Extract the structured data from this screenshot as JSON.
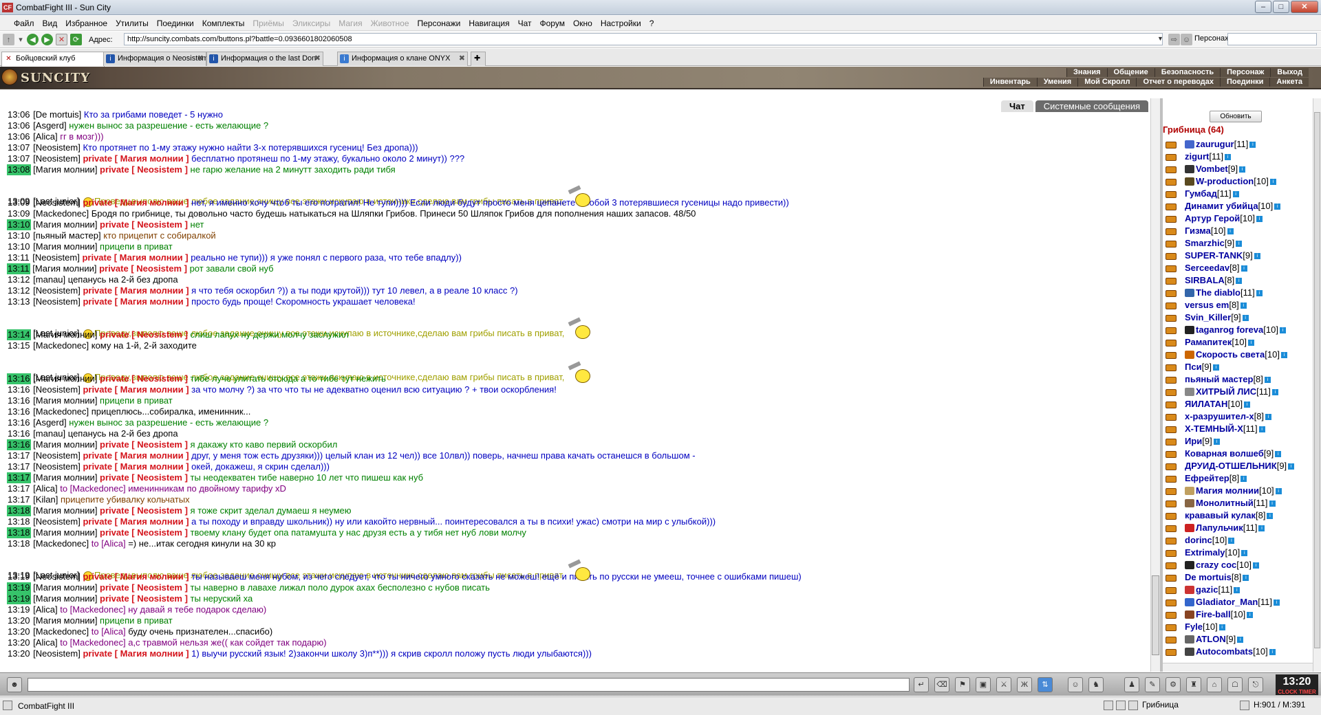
{
  "window": {
    "title": "CombatFight III - Sun City"
  },
  "menu": [
    "Файл",
    "Вид",
    "Избранное",
    "Утилиты",
    "Поединки",
    "Комплекты",
    "Приёмы",
    "Эликсиры",
    "Магия",
    "Животное",
    "Персонажи",
    "Навигация",
    "Чат",
    "Форум",
    "Окно",
    "Настройки",
    "?"
  ],
  "menu_disabled": [
    6,
    7,
    8,
    9
  ],
  "address": {
    "label": "Адрес:",
    "url": "http://suncity.combats.com/buttons.pl?battle=0.0936601802060508",
    "persona_label": "Персонаж:"
  },
  "tabs": [
    {
      "label": "Бойцовский клуб",
      "active": true
    },
    {
      "label": "Информация о Neosistem"
    },
    {
      "label": "Информация о the last Don"
    },
    {
      "label": "Информация о клане ONYX"
    }
  ],
  "header": {
    "logo": "SUNCITY",
    "top_links": [
      "Знания",
      "Общение",
      "Безопасность",
      "Персонаж",
      "Выход"
    ],
    "bottom_links": [
      "Инвентарь",
      "Умения",
      "Мой Скролл",
      "Отчет о переводах",
      "Поединки",
      "Анкета"
    ]
  },
  "chat_tabs": [
    {
      "label": "Чат",
      "active": true
    },
    {
      "label": "Системные сообщения"
    }
  ],
  "chat_lines": [
    {
      "t": "13:06",
      "n": "De mortuis",
      "m": "Кто за грибами поведет - 5 нужно",
      "c": "blue"
    },
    {
      "t": "13:06",
      "n": "Asgerd",
      "m": "нужен вынос за разрешение - есть желающие ?",
      "c": "green"
    },
    {
      "t": "13:06",
      "n": "Alica",
      "m": "гг в мозг)))",
      "c": "purple"
    },
    {
      "t": "13:07",
      "n": "Neosistem",
      "m": "Кто протянет по 1-му этажу нужно найти 3-х потерявшихся гусениц! Без дропа)))",
      "c": "blue"
    },
    {
      "t": "13:07",
      "n": "Neosistem",
      "p": "Магия молнии",
      "m": "бесплатно протянеш по 1-му этажу, букально около 2 минут)) ???",
      "c": "blue"
    },
    {
      "t": "13:08",
      "hl": true,
      "n": "Магия молнии",
      "p": "Neosistem",
      "m": "не гарю желание на 2 минутт заходить ради тибя",
      "c": "green"
    },
    {
      "t": "13:09",
      "n": "Last junior",
      "m": "Проведу,выполю ваше любое задание,очищу все этажи,искупаю в источнике,сделаю вам грибы писать в приват,",
      "c": "olive",
      "s": true,
      "tall": true
    },
    {
      "t": "13:09",
      "n": "Neosistem",
      "p": "Магия молнии",
      "m": "нет, я именно хочу чтоб ты его потратил! Не тупи)))) Если люди будут просто меня цепанете с собой 3 потерявшиеся гусеницы надо привести))",
      "c": "blue"
    },
    {
      "t": "13:09",
      "n": "Mackedonec",
      "m": "Бродя по грибнице, ты довольно часто будешь натыкаться на Шляпки Грибов. Принеси 50 Шляпок Грибов для пополнения наших запасов. 48/50",
      "c": "dark"
    },
    {
      "t": "13:10",
      "hl": true,
      "n": "Магия молнии",
      "p": "Neosistem",
      "m": "нет",
      "c": "green"
    },
    {
      "t": "13:10",
      "n": "пьяный мастер",
      "m": "кто прицепит с собиралкой",
      "c": "brown"
    },
    {
      "t": "13:10",
      "n": "Магия молнии",
      "m": "прицепи в приват",
      "c": "green"
    },
    {
      "t": "13:11",
      "n": "Neosistem",
      "p": "Магия молнии",
      "m": "реально не тупи))) я уже понял с первого раза, что тебе впадлу))",
      "c": "blue"
    },
    {
      "t": "13:11",
      "hl": true,
      "n": "Магия молнии",
      "p": "Neosistem",
      "m": "рот завали свой нуб",
      "c": "green"
    },
    {
      "t": "13:12",
      "n": "manau",
      "m": "цепанусь на 2-й без дропа",
      "c": "dark"
    },
    {
      "t": "13:12",
      "n": "Neosistem",
      "p": "Магия молнии",
      "m": "я что тебя оскорбил ?)) а ты поди крутой))) тут 10 левел, а в реале 10 класс ?)",
      "c": "blue"
    },
    {
      "t": "13:13",
      "n": "Neosistem",
      "p": "Магия молнии",
      "m": "просто будь проще! Скоромность украшает человека!",
      "c": "blue"
    },
    {
      "t": "13:14",
      "n": "Last junior",
      "m": "Проведу,выполю ваше любое задание,очищу все этажи,искупаю в источнике,сделаю вам грибы писать в приват,",
      "c": "olive",
      "s": true,
      "tall": true
    },
    {
      "t": "13:14",
      "hl": true,
      "n": "Магия молнии",
      "p": "Neosistem",
      "m": "слиш лапух ну держи молчу заслужил",
      "c": "green"
    },
    {
      "t": "13:15",
      "n": "Mackedonec",
      "m": "кому на 1-й, 2-й заходите",
      "c": "dark"
    },
    {
      "t": "13:15",
      "n": "Last junior",
      "m": "Проведу,выполю ваше любое задание,очищу все этажи,искупаю в источнике,сделаю вам грибы писать в приват,",
      "c": "olive",
      "s": true,
      "tall": true
    },
    {
      "t": "13:16",
      "hl": true,
      "n": "Магия молнии",
      "p": "Neosistem",
      "m": "тибе луче улитать отсюда а то тибе тут нежить",
      "c": "green"
    },
    {
      "t": "13:16",
      "n": "Neosistem",
      "p": "Магия молнии",
      "m": "за что молчу ?) за что что ты не адекватно оценил всю ситуацию ? + твои оскорбления!",
      "c": "blue"
    },
    {
      "t": "13:16",
      "n": "Магия молнии",
      "m": "прицепи в приват",
      "c": "green"
    },
    {
      "t": "13:16",
      "n": "Mackedonec",
      "m": "прицеплюсь...собиралка, именинник...",
      "c": "dark"
    },
    {
      "t": "13:16",
      "n": "Asgerd",
      "m": "нужен вынос за разрешение - есть желающие ?",
      "c": "green"
    },
    {
      "t": "13:16",
      "n": "manau",
      "m": "цепанусь на 2-й без дропа",
      "c": "dark"
    },
    {
      "t": "13:16",
      "hl": true,
      "n": "Магия молнии",
      "p": "Neosistem",
      "m": "я дакажу кто каво первий оскорбил",
      "c": "green"
    },
    {
      "t": "13:17",
      "n": "Neosistem",
      "p": "Магия молнии",
      "m": "друг, у меня тож есть друзяки))) целый клан из 12 чел)) все 10лвл)) поверь, начнеш права качать останешся в большом -",
      "c": "blue"
    },
    {
      "t": "13:17",
      "n": "Neosistem",
      "p": "Магия молнии",
      "m": "окей, докажеш, я скрин сделал)))",
      "c": "blue"
    },
    {
      "t": "13:17",
      "hl": true,
      "n": "Магия молнии",
      "p": "Neosistem",
      "m": "ты неодекватен тибе наверно 10 лет что пишеш как нуб",
      "c": "green"
    },
    {
      "t": "13:17",
      "n": "Alica",
      "to": "to [Mackedonec]",
      "m": "именинникам по двойному тарифу xD",
      "c": "purple"
    },
    {
      "t": "13:17",
      "n": "Kilan",
      "m": "прицепите убивалку кольчатых",
      "c": "brown"
    },
    {
      "t": "13:18",
      "hl": true,
      "n": "Магия молнии",
      "p": "Neosistem",
      "m": "я тоже скрит зделал думаеш я неумею",
      "c": "green"
    },
    {
      "t": "13:18",
      "n": "Neosistem",
      "p": "Магия молнии",
      "m": "а ты походу и вправду школьник)) ну или какойто нервный... поинтересовался а ты в психи! ужас) смотри на мир с улыбкой)))",
      "c": "blue"
    },
    {
      "t": "13:18",
      "hl": true,
      "n": "Магия молнии",
      "p": "Neosistem",
      "m": "твоему клану будет опа патамушта у нас друзя есть а у тибя нет нуб лови молчу",
      "c": "green"
    },
    {
      "t": "13:18",
      "n": "Mackedonec",
      "to": "to [Alica]",
      "m": "=) не...итак сегодня кинули на 30 кр",
      "c": "dark"
    },
    {
      "t": "13:19",
      "n": "Last junior",
      "m": "Проведу,выполю ваше любое задание,очищу все этажи,искупаю в источнике,сделаю вам грибы писать в приват,",
      "c": "olive",
      "s": true,
      "tall": true
    },
    {
      "t": "13:19",
      "n": "Neosistem",
      "p": "Магия молнии",
      "m": "ты называеш меня нубом, из чего следует, что ты ничего умного сказать не можеш! ещё и писать по русски не умееш, точнее с ошибками пишеш)",
      "c": "blue"
    },
    {
      "t": "13:19",
      "hl": true,
      "n": "Магия молнии",
      "p": "Neosistem",
      "m": "ты наверно в лавахе лижал поло дурок ахах бесполезно с нубов писать",
      "c": "green"
    },
    {
      "t": "13:19",
      "hl": true,
      "n": "Магия молнии",
      "p": "Neosistem",
      "m": "ты неруский ха",
      "c": "green"
    },
    {
      "t": "13:19",
      "n": "Alica",
      "to": "to [Mackedonec]",
      "m": "ну давай я тебе подарок сделаю)",
      "c": "purple"
    },
    {
      "t": "13:20",
      "n": "Магия молнии",
      "m": "прицепи в приват",
      "c": "green"
    },
    {
      "t": "13:20",
      "n": "Mackedonec",
      "to": "to [Alica]",
      "m": "буду очень признателен...спасибо)",
      "c": "dark"
    },
    {
      "t": "13:20",
      "n": "Alica",
      "to": "to [Mackedonec]",
      "m": "а,с травмой нельзя же(( как сойдет так подарю)",
      "c": "purple"
    },
    {
      "t": "13:20",
      "n": "Neosistem",
      "p": "Магия молнии",
      "m": "1) выучи русский язык! 2)закончи школу 3)п**))) я скрив скролл положу пусть люди улыбаются)))",
      "c": "blue"
    }
  ],
  "panel": {
    "refresh": "Обновить",
    "room": "Грибница (64)"
  },
  "users": [
    {
      "n": "zaurugur",
      "l": "[11]",
      "clan": "#4466cc"
    },
    {
      "n": "zigurt",
      "l": "[11]"
    },
    {
      "n": "Vombet",
      "l": "[9]",
      "clan": "#333"
    },
    {
      "n": "W-production",
      "l": "[10]",
      "clan": "#5a4a20"
    },
    {
      "n": "Гумбад",
      "l": "[11]"
    },
    {
      "n": "Динамит убийца",
      "l": "[10]"
    },
    {
      "n": "Артур Герой",
      "l": "[10]"
    },
    {
      "n": "Гизма",
      "l": "[10]"
    },
    {
      "n": "Smarzhic",
      "l": "[9]"
    },
    {
      "n": "SUPER-TANK",
      "l": "[9]"
    },
    {
      "n": "Serceedav",
      "l": "[8]"
    },
    {
      "n": "SIRBALA",
      "l": "[8]"
    },
    {
      "n": "The diablo",
      "l": "[11]",
      "clan": "#3366aa"
    },
    {
      "n": "versus em",
      "l": "[8]"
    },
    {
      "n": "Svin_Killer",
      "l": "[9]"
    },
    {
      "n": "taganrog foreva",
      "l": "[10]",
      "clan": "#222"
    },
    {
      "n": "Рамапитек",
      "l": "[10]"
    },
    {
      "n": "Скорость света",
      "l": "[10]",
      "clan": "#cc6600"
    },
    {
      "n": "Пси",
      "l": "[9]"
    },
    {
      "n": "пьяный мастер",
      "l": "[8]"
    },
    {
      "n": "ХИТРЫЙ ЛИС",
      "l": "[11]",
      "clan": "#888"
    },
    {
      "n": "ЯИЛАТАН",
      "l": "[10]"
    },
    {
      "n": "x-разрушител-x",
      "l": "[8]"
    },
    {
      "n": "X-ТЕМНЫЙ-X",
      "l": "[11]"
    },
    {
      "n": "Ири",
      "l": "[9]"
    },
    {
      "n": "Коварная волшеб",
      "l": "[9]"
    },
    {
      "n": "ДРУИД-ОТШЕЛЬНИК",
      "l": "[9]"
    },
    {
      "n": "Ефрейтер",
      "l": "[8]"
    },
    {
      "n": "Магия молнии",
      "l": "[10]",
      "clan": "#c0a060"
    },
    {
      "n": "Монолитный",
      "l": "[11]",
      "clan": "#886644"
    },
    {
      "n": "крававый кулак",
      "l": "[8]"
    },
    {
      "n": "Лапульчик",
      "l": "[11]",
      "clan": "#cc2222"
    },
    {
      "n": "dorinc",
      "l": "[10]"
    },
    {
      "n": "Extrimaly",
      "l": "[10]"
    },
    {
      "n": "crazy coc",
      "l": "[10]",
      "clan": "#222"
    },
    {
      "n": "De mortuis",
      "l": "[8]"
    },
    {
      "n": "gazic",
      "l": "[11]",
      "clan": "#cc3333"
    },
    {
      "n": "Gladiator_Man",
      "l": "[11]",
      "clan": "#3366cc"
    },
    {
      "n": "Fire-ball",
      "l": "[10]",
      "clan": "#884422"
    },
    {
      "n": "Fyle",
      "l": "[10]"
    },
    {
      "n": "ATLON",
      "l": "[9]",
      "clan": "#666"
    },
    {
      "n": "Autocombats",
      "l": "[10]",
      "clan": "#444"
    }
  ],
  "clock": {
    "time": "13:20",
    "sub": "CLOCK TIMER"
  },
  "status": {
    "app": "CombatFight III",
    "location": "Грибница",
    "hp": "H:901 / M:391"
  },
  "colors": {
    "green": "#008000",
    "blue": "#0000c0",
    "purple": "#800080",
    "olive": "#a0a000",
    "brown": "#804000",
    "dark": "#000000",
    "private": "#d4141c",
    "time_highlight": "#36c36a"
  }
}
